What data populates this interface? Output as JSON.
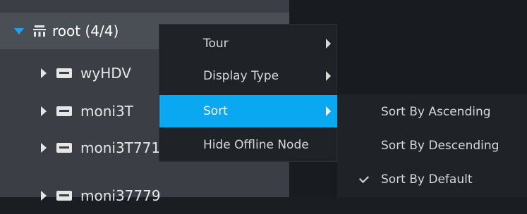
{
  "tree": {
    "root_label": "root (4/4)",
    "items": [
      {
        "label": "wyHDV"
      },
      {
        "label": "moni3T"
      },
      {
        "label": "moni3T771"
      },
      {
        "label": "moni37779"
      }
    ]
  },
  "context_menu": {
    "items": [
      {
        "label": "Tour",
        "has_submenu": true
      },
      {
        "label": "Display Type",
        "has_submenu": true
      },
      {
        "label": "Sort",
        "has_submenu": true,
        "active": true
      },
      {
        "label": "Hide Offline Node",
        "has_submenu": false
      }
    ]
  },
  "sort_submenu": {
    "items": [
      {
        "label": "Sort By Ascending",
        "checked": false
      },
      {
        "label": "Sort By Descending",
        "checked": false
      },
      {
        "label": "Sort By Default",
        "checked": true
      }
    ]
  },
  "colors": {
    "accent": "#0aa8f0",
    "tree_bg": "#3b3f45",
    "menu_bg": "#1f2227"
  }
}
